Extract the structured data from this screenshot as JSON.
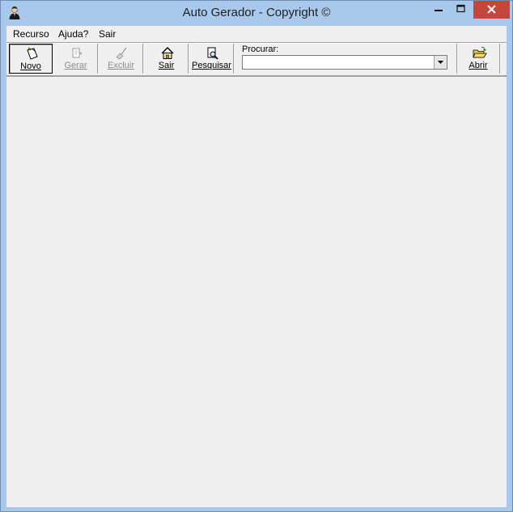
{
  "window": {
    "title": "Auto Gerador - Copyright ©"
  },
  "menu": {
    "items": [
      "Recurso",
      "Ajuda?",
      "Sair"
    ]
  },
  "toolbar": {
    "buttons": [
      {
        "label": "Novo",
        "icon": "new-note-icon",
        "enabled": true,
        "pressed": true
      },
      {
        "label": "Gerar",
        "icon": "generate-icon",
        "enabled": false
      },
      {
        "label": "Excluir",
        "icon": "broom-icon",
        "enabled": false
      },
      {
        "label": "Sair",
        "icon": "home-icon",
        "enabled": true
      },
      {
        "label": "Pesquisar",
        "icon": "magnifier-icon",
        "enabled": true
      }
    ],
    "search": {
      "label": "Procurar:",
      "value": ""
    },
    "open_button": {
      "label": "Abrir",
      "icon": "open-folder-icon"
    }
  }
}
